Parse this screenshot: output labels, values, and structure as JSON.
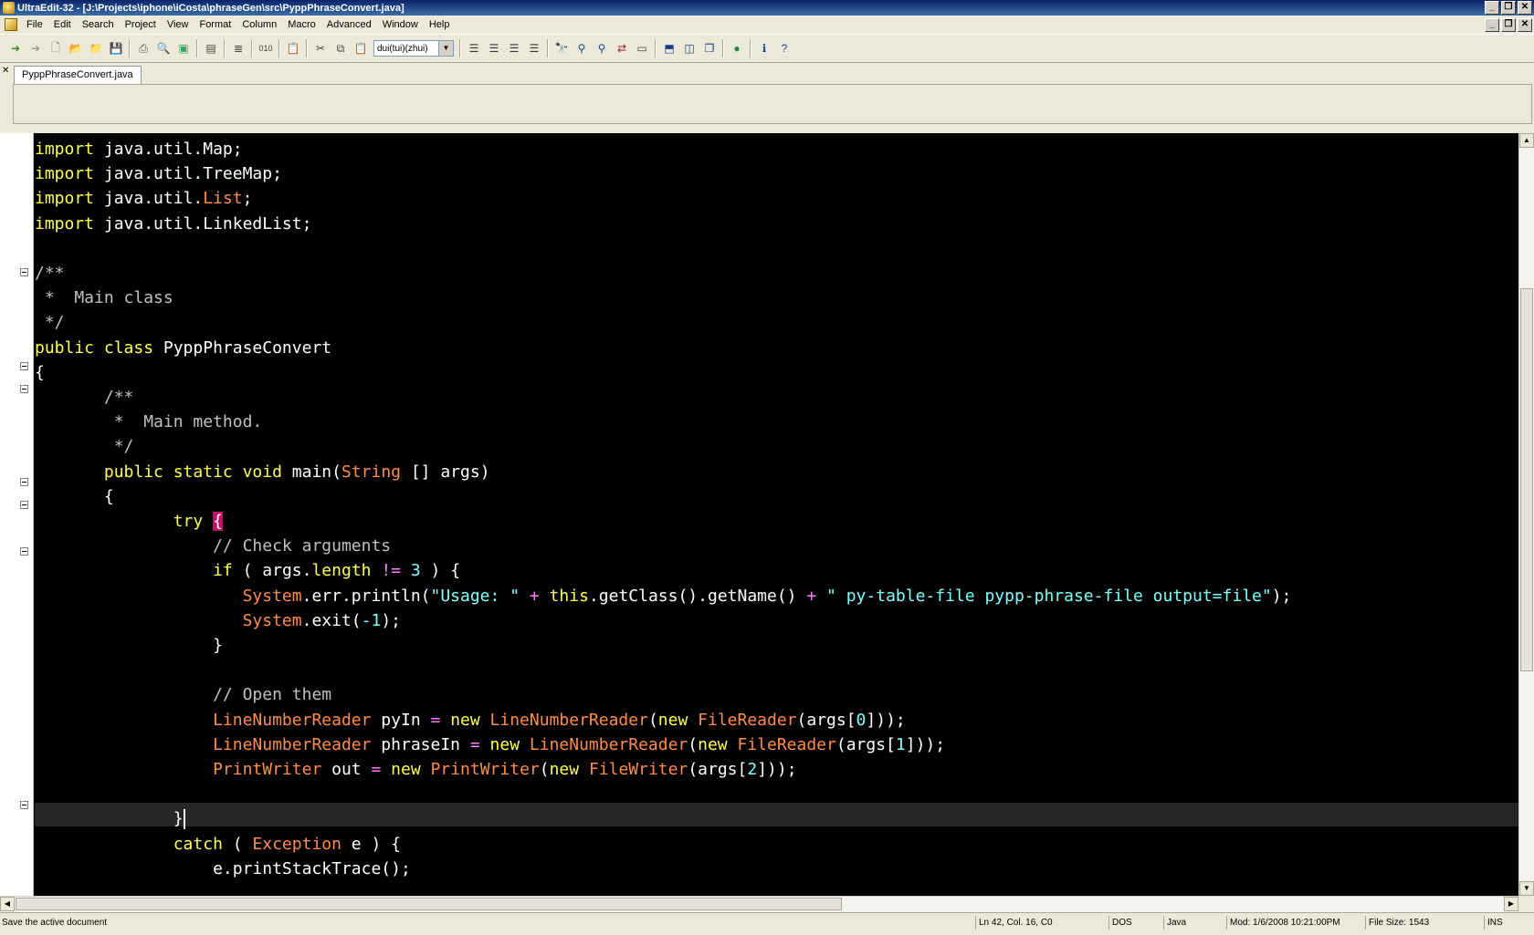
{
  "window": {
    "title": "UltraEdit-32 - [J:\\Projects\\iphone\\iCosta\\phraseGen\\src\\PyppPhraseConvert.java]"
  },
  "menu": [
    "File",
    "Edit",
    "Search",
    "Project",
    "View",
    "Format",
    "Column",
    "Macro",
    "Advanced",
    "Window",
    "Help"
  ],
  "toolbar": {
    "font_combo_value": "dui(tui)(zhui)"
  },
  "tabs": [
    {
      "label": "PyppPhraseConvert.java",
      "active": true
    }
  ],
  "editor": {
    "lines": [
      [
        [
          "kw",
          "import"
        ],
        [
          "pl",
          " java.util.Map;"
        ]
      ],
      [
        [
          "kw",
          "import"
        ],
        [
          "pl",
          " java.util.TreeMap;"
        ]
      ],
      [
        [
          "kw",
          "import"
        ],
        [
          "pl",
          " java.util."
        ],
        [
          "ty",
          "List"
        ],
        [
          "pl",
          ";"
        ]
      ],
      [
        [
          "kw",
          "import"
        ],
        [
          "pl",
          " java.util.LinkedList;"
        ]
      ],
      [],
      [
        [
          "cm",
          "/**"
        ]
      ],
      [
        [
          "cm",
          " *  Main class"
        ]
      ],
      [
        [
          "cm",
          " */"
        ]
      ],
      [
        [
          "kw",
          "public class"
        ],
        [
          "pl",
          " PyppPhraseConvert"
        ]
      ],
      [
        [
          "pl",
          "{"
        ]
      ],
      [
        [
          "cm",
          "       /**"
        ]
      ],
      [
        [
          "cm",
          "        *  Main method."
        ]
      ],
      [
        [
          "cm",
          "        */"
        ]
      ],
      [
        [
          "pl",
          "       "
        ],
        [
          "kw",
          "public static void"
        ],
        [
          "pl",
          " main("
        ],
        [
          "ty",
          "String"
        ],
        [
          "pl",
          " [] args)"
        ]
      ],
      [
        [
          "pl",
          "       {"
        ]
      ],
      [
        [
          "pl",
          "              "
        ],
        [
          "kw",
          "try"
        ],
        [
          "pl",
          " "
        ],
        [
          "hl",
          "{"
        ]
      ],
      [
        [
          "pl",
          "                  "
        ],
        [
          "cm",
          "// Check arguments"
        ]
      ],
      [
        [
          "pl",
          "                  "
        ],
        [
          "kw",
          "if"
        ],
        [
          "pl",
          " ( args."
        ],
        [
          "kw",
          "length"
        ],
        [
          "pl",
          " "
        ],
        [
          "op",
          "!="
        ],
        [
          "pl",
          " "
        ],
        [
          "nm",
          "3"
        ],
        [
          "pl",
          " ) {"
        ]
      ],
      [
        [
          "pl",
          "                     "
        ],
        [
          "ty",
          "System"
        ],
        [
          "pl",
          ".err.println("
        ],
        [
          "st",
          "\"Usage: \""
        ],
        [
          "pl",
          " "
        ],
        [
          "op",
          "+"
        ],
        [
          "pl",
          " "
        ],
        [
          "kw",
          "this"
        ],
        [
          "pl",
          ".getClass().getName() "
        ],
        [
          "op",
          "+"
        ],
        [
          "pl",
          " "
        ],
        [
          "st",
          "\" py-table-file pypp-phrase-file output=file\""
        ],
        [
          "pl",
          ");"
        ]
      ],
      [
        [
          "pl",
          "                     "
        ],
        [
          "ty",
          "System"
        ],
        [
          "pl",
          ".exit("
        ],
        [
          "nm",
          "-1"
        ],
        [
          "pl",
          ");"
        ]
      ],
      [
        [
          "pl",
          "                  }"
        ]
      ],
      [],
      [
        [
          "pl",
          "                  "
        ],
        [
          "cm",
          "// Open them"
        ]
      ],
      [
        [
          "pl",
          "                  "
        ],
        [
          "ty",
          "LineNumberReader"
        ],
        [
          "pl",
          " pyIn "
        ],
        [
          "op",
          "="
        ],
        [
          "pl",
          " "
        ],
        [
          "kw",
          "new"
        ],
        [
          "pl",
          " "
        ],
        [
          "ty",
          "LineNumberReader"
        ],
        [
          "pl",
          "("
        ],
        [
          "kw",
          "new"
        ],
        [
          "pl",
          " "
        ],
        [
          "ty",
          "FileReader"
        ],
        [
          "pl",
          "(args["
        ],
        [
          "nm",
          "0"
        ],
        [
          "pl",
          "]));"
        ]
      ],
      [
        [
          "pl",
          "                  "
        ],
        [
          "ty",
          "LineNumberReader"
        ],
        [
          "pl",
          " phraseIn "
        ],
        [
          "op",
          "="
        ],
        [
          "pl",
          " "
        ],
        [
          "kw",
          "new"
        ],
        [
          "pl",
          " "
        ],
        [
          "ty",
          "LineNumberReader"
        ],
        [
          "pl",
          "("
        ],
        [
          "kw",
          "new"
        ],
        [
          "pl",
          " "
        ],
        [
          "ty",
          "FileReader"
        ],
        [
          "pl",
          "(args["
        ],
        [
          "nm",
          "1"
        ],
        [
          "pl",
          "]));"
        ]
      ],
      [
        [
          "pl",
          "                  "
        ],
        [
          "ty",
          "PrintWriter"
        ],
        [
          "pl",
          " out "
        ],
        [
          "op",
          "="
        ],
        [
          "pl",
          " "
        ],
        [
          "kw",
          "new"
        ],
        [
          "pl",
          " "
        ],
        [
          "ty",
          "PrintWriter"
        ],
        [
          "pl",
          "("
        ],
        [
          "kw",
          "new"
        ],
        [
          "pl",
          " "
        ],
        [
          "ty",
          "FileWriter"
        ],
        [
          "pl",
          "(args["
        ],
        [
          "nm",
          "2"
        ],
        [
          "pl",
          "]));"
        ]
      ],
      [],
      [
        [
          "pl",
          "              }"
        ],
        [
          "cursor",
          ""
        ]
      ],
      [
        [
          "pl",
          "              "
        ],
        [
          "kw",
          "catch"
        ],
        [
          "pl",
          " ( "
        ],
        [
          "ty",
          "Exception"
        ],
        [
          "pl",
          " e ) {"
        ]
      ],
      [
        [
          "pl",
          "                  e.printStackTrace();"
        ]
      ]
    ]
  },
  "status": {
    "message": "Save the active document",
    "position": "Ln 42, Col. 16, C0",
    "line_ending": "DOS",
    "language": "Java",
    "modified": "Mod: 1/6/2008 10:21:00PM",
    "file_size": "File Size: 1543",
    "insert_mode": "INS"
  }
}
